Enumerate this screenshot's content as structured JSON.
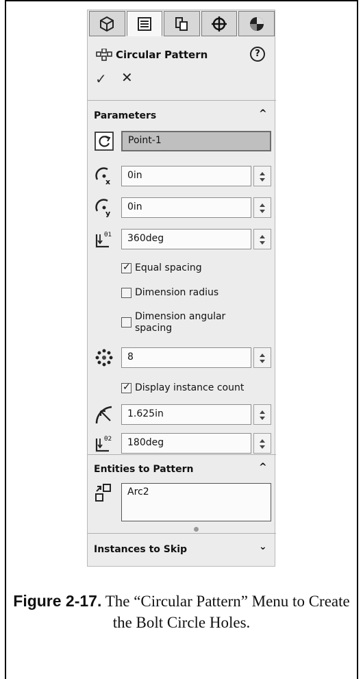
{
  "tabs": [
    {
      "icon": "feature-tree-icon"
    },
    {
      "icon": "property-manager-icon",
      "active": true
    },
    {
      "icon": "configuration-manager-icon"
    },
    {
      "icon": "dimxpert-icon"
    },
    {
      "icon": "display-manager-icon"
    }
  ],
  "header": {
    "title": "Circular Pattern",
    "help_label": "?",
    "ok_label": "✓",
    "cancel_label": "✕"
  },
  "parameters": {
    "title": "Parameters",
    "center": "Point-1",
    "center_x": "0in",
    "center_y": "0in",
    "angle": "360deg",
    "equal_spacing": {
      "label": "Equal spacing",
      "checked": true
    },
    "dimension_radius": {
      "label": "Dimension radius",
      "checked": false
    },
    "dimension_angular": {
      "label": "Dimension angular spacing",
      "checked": false
    },
    "instances": "8",
    "display_count": {
      "label": "Display instance count",
      "checked": true
    },
    "radius": "1.625in",
    "start_angle": "180deg"
  },
  "entities": {
    "title": "Entities to Pattern",
    "value": "Arc2"
  },
  "skip": {
    "title": "Instances to Skip"
  },
  "caption": {
    "figure": "Figure 2-17.",
    "text": "The “Circular Pattern” Menu to Create the Bolt Circle Holes."
  }
}
